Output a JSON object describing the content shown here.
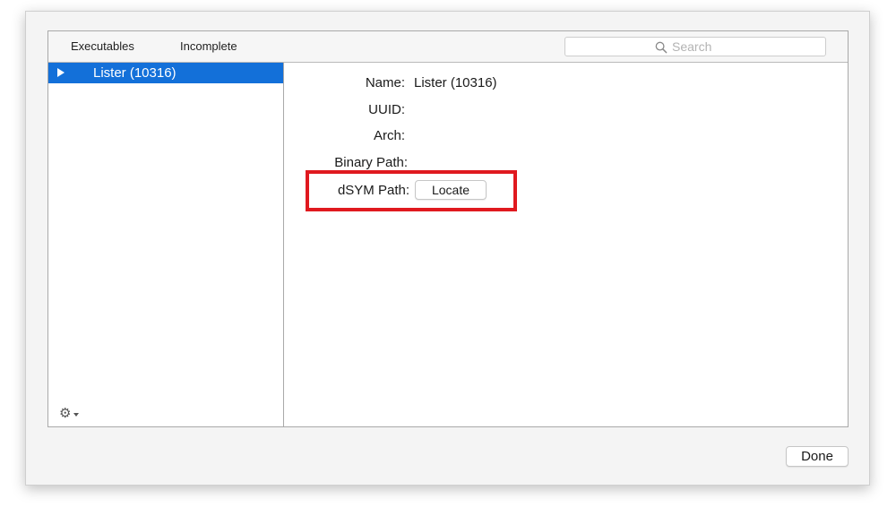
{
  "tabs": [
    {
      "label": "Executables"
    },
    {
      "label": "Incomplete"
    }
  ],
  "search": {
    "placeholder": "Search"
  },
  "sidebar": {
    "items": [
      {
        "label": "Lister (10316)",
        "selected": true,
        "icon": "disclosure-triangle-icon"
      }
    ],
    "footer_icon": "gear-icon"
  },
  "detail": {
    "name_label": "Name:",
    "name_value": "Lister (10316)",
    "uuid_label": "UUID:",
    "arch_label": "Arch:",
    "binary_path_label": "Binary Path:",
    "dsym_path_label": "dSYM Path:",
    "locate_label": "Locate"
  },
  "footer": {
    "done_label": "Done"
  },
  "colors": {
    "selection": "#1370d9",
    "highlight_box": "#e0191f"
  }
}
